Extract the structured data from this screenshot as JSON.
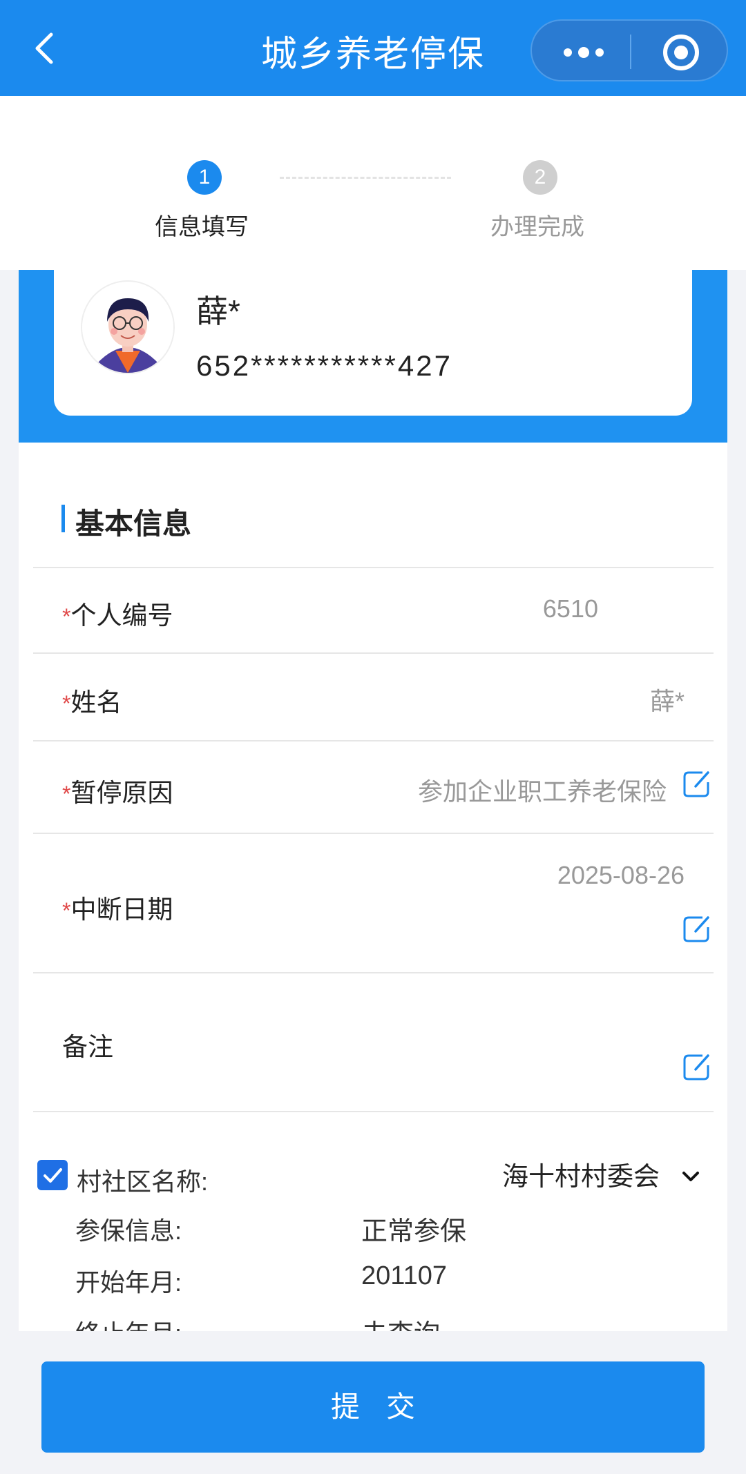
{
  "nav": {
    "title": "城乡养老停保"
  },
  "steps": [
    {
      "number": "1",
      "label": "信息填写"
    },
    {
      "number": "2",
      "label": "办理完成"
    }
  ],
  "user": {
    "name": "薛*",
    "id_number": "652***********427"
  },
  "section": {
    "title": "基本信息"
  },
  "form": {
    "personal_id": {
      "label": "个人编号",
      "value": "6510"
    },
    "name": {
      "label": "姓名",
      "value": "薛*"
    },
    "pause_reason": {
      "label": "暂停原因",
      "value": "参加企业职工养老保险"
    },
    "interrupt_date": {
      "label": "中断日期",
      "value": "2025-08-26"
    },
    "remark": {
      "label": "备注",
      "value": ""
    },
    "required_mark": "*"
  },
  "village": {
    "label": "村社区名称:",
    "value": "海十村村委会",
    "checked": true
  },
  "insurance": [
    {
      "label": "参保信息:",
      "value": "正常参保"
    },
    {
      "label": "开始年月:",
      "value": "201107"
    },
    {
      "label": "终止年月:",
      "value": "未查询"
    }
  ],
  "submit_label": "提交",
  "colors": {
    "primary": "#1b8aee",
    "required": "#e04848",
    "muted": "#999999"
  },
  "icons": [
    "back-icon",
    "more-icon",
    "close-target-icon",
    "avatar-icon",
    "edit-icon",
    "checkbox-icon",
    "chevron-down-icon"
  ]
}
